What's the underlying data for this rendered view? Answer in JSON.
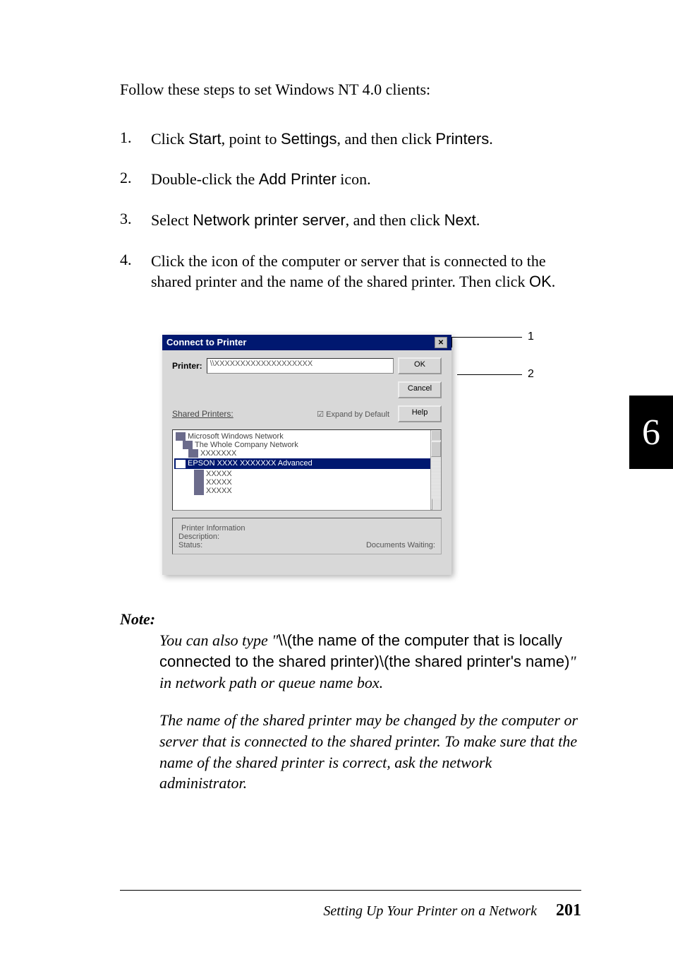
{
  "intro": "Follow these steps to set Windows NT 4.0 clients:",
  "steps": [
    {
      "num": "1.",
      "parts": [
        {
          "t": "Click ",
          "f": "serif"
        },
        {
          "t": "Start",
          "f": "ui"
        },
        {
          "t": ", point to ",
          "f": "serif"
        },
        {
          "t": "Settings",
          "f": "ui"
        },
        {
          "t": ", and then click ",
          "f": "serif"
        },
        {
          "t": "Printers",
          "f": "ui"
        },
        {
          "t": ".",
          "f": "serif"
        }
      ]
    },
    {
      "num": "2.",
      "parts": [
        {
          "t": "Double-click the ",
          "f": "serif"
        },
        {
          "t": "Add Printer",
          "f": "ui"
        },
        {
          "t": " icon.",
          "f": "serif"
        }
      ]
    },
    {
      "num": "3.",
      "parts": [
        {
          "t": "Select ",
          "f": "serif"
        },
        {
          "t": "Network printer server",
          "f": "ui"
        },
        {
          "t": ", and then click ",
          "f": "serif"
        },
        {
          "t": "Next",
          "f": "ui"
        },
        {
          "t": ".",
          "f": "serif"
        }
      ]
    },
    {
      "num": "4.",
      "parts": [
        {
          "t": "Click the icon of the computer or server that is connected to the shared printer and the name of the shared printer. Then click ",
          "f": "serif"
        },
        {
          "t": "OK",
          "f": "ui"
        },
        {
          "t": ".",
          "f": "serif"
        }
      ]
    }
  ],
  "dialog": {
    "title": "Connect to Printer",
    "close": "✕",
    "printer_label": "Printer:",
    "printer_value": "\\\\XXXXXXXXXXXXXXXXXXX",
    "ok": "OK",
    "cancel": "Cancel",
    "shared_label": "Shared Printers:",
    "expand_cb": "Expand by Default",
    "help": "Help",
    "list_lines": [
      "Microsoft Windows Network",
      "The Whole Company Network",
      "XXXXXXX"
    ],
    "selected_line": "EPSON XXXX XXXXXXX Advanced",
    "after_lines": [
      "XXXXX",
      "XXXXX",
      "XXXXX"
    ],
    "info_title": "Printer Information",
    "info_desc": "Description:",
    "info_status_label": "Status:",
    "info_status_value": "Documents Waiting:"
  },
  "callouts": {
    "c1": "1",
    "c2": "2"
  },
  "note": {
    "head": "Note:",
    "p1_pre": "You can also type \"",
    "p1_ui": "\\\\(the name of the computer that is locally connected to the shared printer)\\(the shared printer's name)",
    "p1_post": "\" in network path or queue name box.",
    "p2": "The name of the shared printer may be changed by the computer or server that is connected to the shared printer. To make sure that the name of the shared printer is correct, ask the network administrator."
  },
  "footer": {
    "title": "Setting Up Your Printer on a Network",
    "page": "201"
  },
  "tab": "6"
}
